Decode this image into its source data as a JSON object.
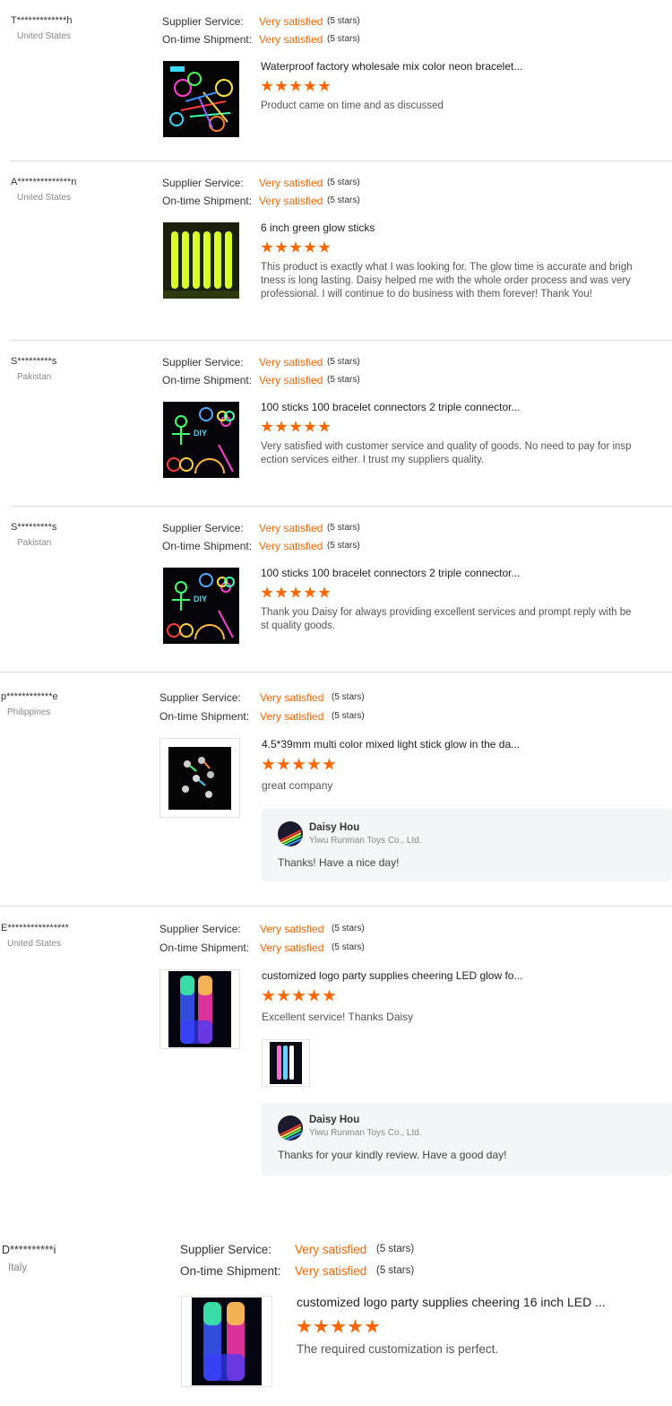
{
  "labels": {
    "supplier_service": "Supplier Service:",
    "ontime_shipment": "On-time Shipment:"
  },
  "colors": {
    "accent": "#ff6600",
    "divider": "#dcdcdc",
    "reply_bg": "#f4f5f7"
  },
  "reviews": [
    {
      "buyer": "T*************h",
      "country": "United States",
      "supplier_service": {
        "value": "Very satisfied",
        "stars": "(5 stars)"
      },
      "ontime_shipment": {
        "value": "Very satisfied",
        "stars": "(5 stars)"
      },
      "product_title": "Waterproof factory wholesale mix color neon bracelet...",
      "product_image": "glow-bracelets-mix-image",
      "rating": 5,
      "comment": "Product came on time and as discussed"
    },
    {
      "buyer": "A**************n",
      "country": "United States",
      "supplier_service": {
        "value": "Very satisfied",
        "stars": "(5 stars)"
      },
      "ontime_shipment": {
        "value": "Very satisfied",
        "stars": "(5 stars)"
      },
      "product_title": "6 inch green glow sticks",
      "product_image": "green-glow-sticks-image",
      "rating": 5,
      "comment_lines": [
        "This product is exactly what I was looking for. The glow time is accurate and brigh",
        "tness is long lasting. Daisy helped me with the whole order process and was very",
        "professional. I will continue to do business with them forever! Thank You!"
      ]
    },
    {
      "buyer": "S*********s",
      "country": "Pakistan",
      "supplier_service": {
        "value": "Very satisfied",
        "stars": "(5 stars)"
      },
      "ontime_shipment": {
        "value": "Very satisfied",
        "stars": "(5 stars)"
      },
      "product_title": "100 sticks 100 bracelet connectors 2 triple connector...",
      "product_image": "diy-glow-kit-image",
      "rating": 5,
      "comment_lines": [
        "Very satisfied with customer service and quality of goods. No need to pay for insp",
        "ection services either. I trust my suppliers quality."
      ]
    },
    {
      "buyer": "S*********s",
      "country": "Pakistan",
      "supplier_service": {
        "value": "Very satisfied",
        "stars": "(5 stars)"
      },
      "ontime_shipment": {
        "value": "Very satisfied",
        "stars": "(5 stars)"
      },
      "product_title": "100 sticks 100 bracelet connectors 2 triple connector...",
      "product_image": "diy-glow-kit-image",
      "rating": 5,
      "comment_lines": [
        "Thank you Daisy for always providing excellent services and prompt reply with be",
        "st quality goods."
      ]
    },
    {
      "buyer": "p************e",
      "country": "Philippines",
      "supplier_service": {
        "value": "Very satisfied",
        "stars": "(5 stars)"
      },
      "ontime_shipment": {
        "value": "Very satisfied",
        "stars": "(5 stars)"
      },
      "product_title": "4.5*39mm multi color mixed light stick glow in the da...",
      "product_image": "light-stick-clips-image",
      "rating": 5,
      "comment": "great company",
      "reply": {
        "name": "Daisy Hou",
        "company": "Yiwu Runman Toys Co., Ltd.",
        "text": "Thanks! Have a nice day!"
      }
    },
    {
      "buyer": "E****************",
      "country": "United States",
      "supplier_service": {
        "value": "Very satisfied",
        "stars": "(5 stars)"
      },
      "ontime_shipment": {
        "value": "Very satisfied",
        "stars": "(5 stars)"
      },
      "product_title": "customized logo party supplies cheering LED glow fo...",
      "product_image": "led-foam-sticks-image",
      "rating": 5,
      "comment": "Excellent service! Thanks Daisy",
      "attachment": "review-photo-thumbnail",
      "reply": {
        "name": "Daisy Hou",
        "company": "Yiwu Runman Toys Co., Ltd.",
        "text": "Thanks for your kindly review. Have a good day!"
      }
    },
    {
      "buyer": "D**********i",
      "country": "Italy",
      "supplier_service": {
        "value": "Very satisfied",
        "stars": "(5 stars)"
      },
      "ontime_shipment": {
        "value": "Very satisfied",
        "stars": "(5 stars)"
      },
      "product_title": "customized logo party supplies cheering 16 inch LED ...",
      "product_image": "led-foam-sticks-image",
      "rating": 5,
      "comment": "The required customization is perfect."
    }
  ]
}
